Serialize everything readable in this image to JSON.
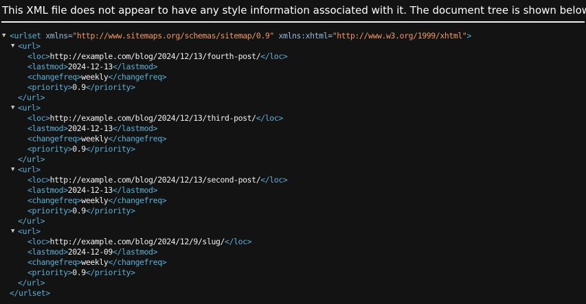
{
  "notice": "This XML file does not appear to have any style information associated with it. The document tree is shown below.",
  "toggle_glyph": "▼",
  "urlset": {
    "open_tag": "<urlset",
    "attr1_name": "xmlns=",
    "attr1_value": "\"http://www.sitemaps.org/schemas/sitemap/0.9\"",
    "attr2_name": "xmlns:xhtml=",
    "attr2_value": "\"http://www.w3.org/1999/xhtml\"",
    "open_end": ">",
    "close_tag": "</urlset>"
  },
  "tags": {
    "url_open": "<url>",
    "url_close": "</url>",
    "loc_open": "<loc>",
    "loc_close": "</loc>",
    "lastmod_open": "<lastmod>",
    "lastmod_close": "</lastmod>",
    "changefreq_open": "<changefreq>",
    "changefreq_close": "</changefreq>",
    "priority_open": "<priority>",
    "priority_close": "</priority>"
  },
  "urls": [
    {
      "loc": "http://example.com/blog/2024/12/13/fourth-post/",
      "lastmod": "2024-12-13",
      "changefreq": "weekly",
      "priority": "0.9"
    },
    {
      "loc": "http://example.com/blog/2024/12/13/third-post/",
      "lastmod": "2024-12-13",
      "changefreq": "weekly",
      "priority": "0.9"
    },
    {
      "loc": "http://example.com/blog/2024/12/13/second-post/",
      "lastmod": "2024-12-13",
      "changefreq": "weekly",
      "priority": "0.9"
    },
    {
      "loc": "http://example.com/blog/2024/12/9/slug/",
      "lastmod": "2024-12-09",
      "changefreq": "weekly",
      "priority": "0.9"
    }
  ]
}
